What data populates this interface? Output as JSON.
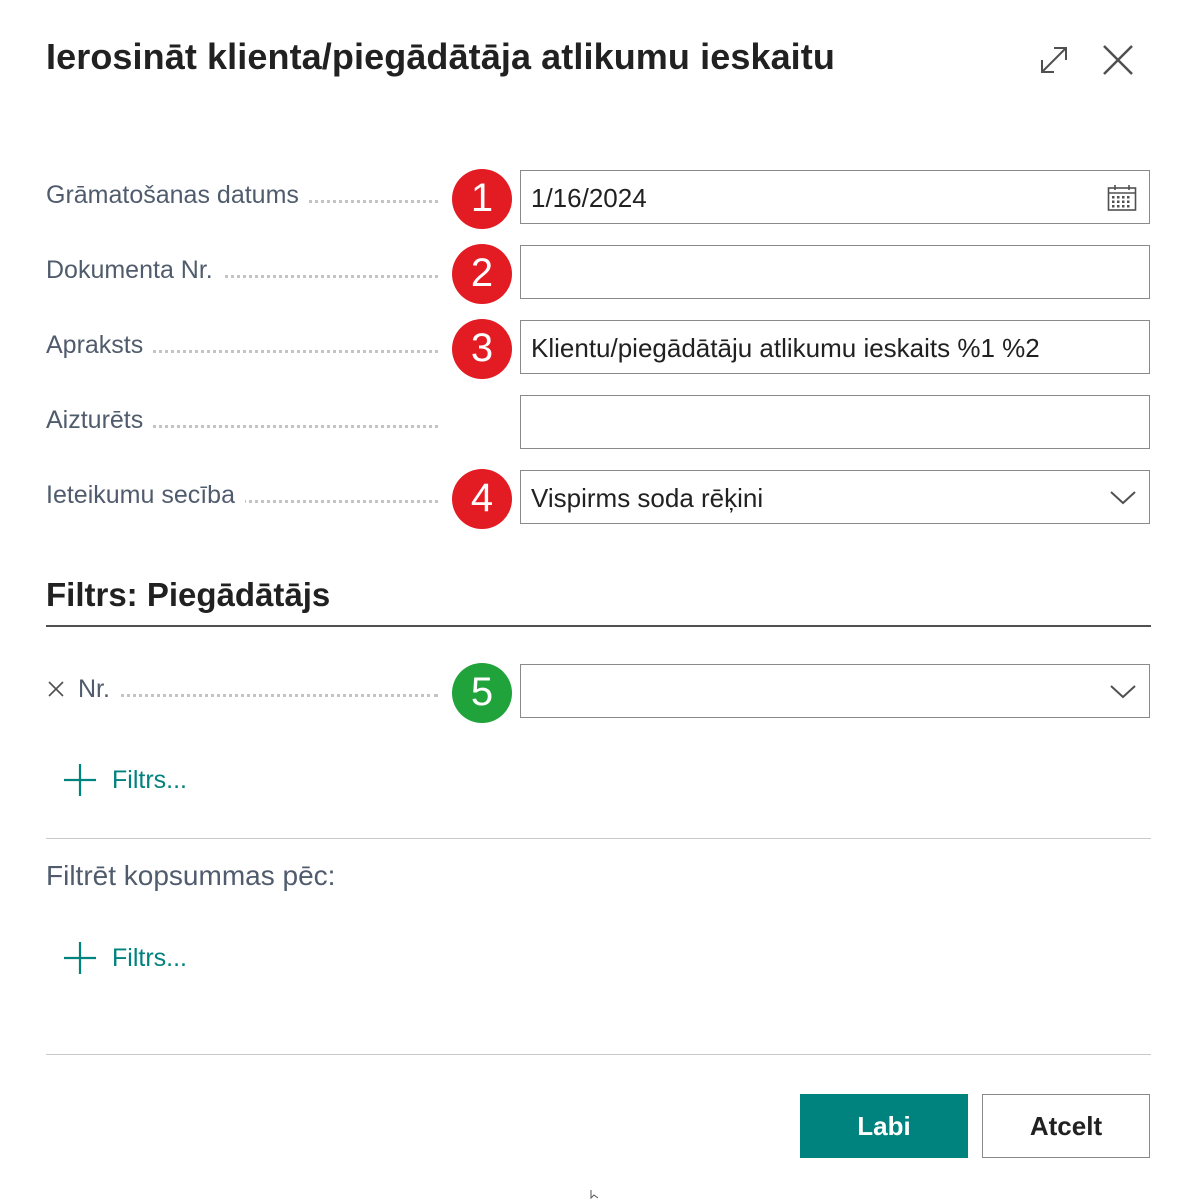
{
  "dialog": {
    "title": "Ierosināt klienta/piegādātāja atlikumu ieskaitu",
    "expand_icon": "expand-icon",
    "close_icon": "close-icon"
  },
  "fields": [
    {
      "label": "Grāmatošanas datums",
      "value": "1/16/2024",
      "badge": "1",
      "badge_color": "#e31b23",
      "control": "date"
    },
    {
      "label": "Dokumenta Nr.",
      "value": "",
      "badge": "2",
      "badge_color": "#e31b23",
      "control": "text"
    },
    {
      "label": "Apraksts",
      "value": "Klientu/piegādātāju atlikumu ieskaits %1 %2",
      "badge": "3",
      "badge_color": "#e31b23",
      "control": "text"
    },
    {
      "label": "Aizturēts",
      "value": "",
      "control": "text"
    },
    {
      "label": "Ieteikumu secība",
      "value": "Vispirms soda rēķini",
      "badge": "4",
      "badge_color": "#e31b23",
      "control": "dropdown"
    }
  ],
  "filter_section": {
    "title": "Filtrs: Piegādātājs",
    "filter_row": {
      "label": "Nr.",
      "value": "",
      "badge": "5",
      "badge_color": "#1fa33a"
    },
    "add_filter_label": "Filtrs..."
  },
  "totals_section": {
    "title": "Filtrēt kopsummas pēc:",
    "add_filter_label": "Filtrs..."
  },
  "buttons": {
    "ok": "Labi",
    "cancel": "Atcelt"
  },
  "colors": {
    "accent": "#00827e",
    "badge_red": "#e31b23",
    "badge_green": "#1fa33a"
  }
}
